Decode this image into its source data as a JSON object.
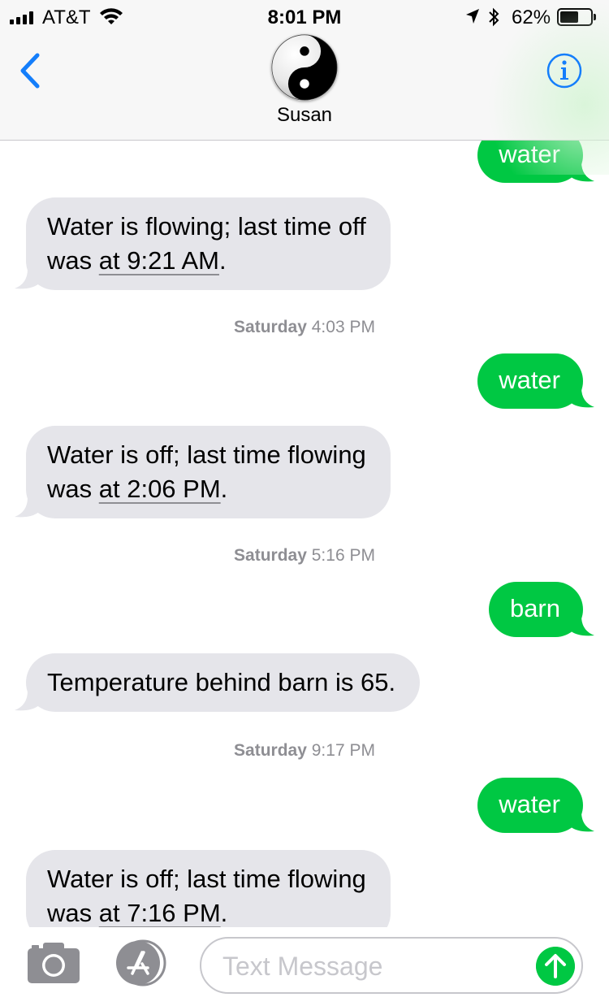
{
  "status_bar": {
    "carrier": "AT&T",
    "time": "8:01 PM",
    "battery_percent": "62%",
    "battery_level": 0.62,
    "icons": [
      "signal-icon",
      "wifi-icon",
      "location-arrow-icon",
      "bluetooth-icon",
      "battery-icon"
    ]
  },
  "header": {
    "contact_name": "Susan",
    "avatar_icon": "yin-yang-icon",
    "back_icon": "chevron-left-icon",
    "info_icon": "info-icon"
  },
  "messages": [
    {
      "kind": "outgoing",
      "text": "water"
    },
    {
      "kind": "incoming",
      "line1": "Water is flowing; last time off",
      "line2_pre": "was ",
      "line2_link": "at 9:21 AM",
      "line2_post": "."
    },
    {
      "kind": "timestamp",
      "day": "Saturday",
      "time": "4:03 PM"
    },
    {
      "kind": "outgoing",
      "text": "water"
    },
    {
      "kind": "incoming",
      "line1": "Water is off; last time flowing",
      "line2_pre": "was ",
      "line2_link": "at 2:06 PM",
      "line2_post": "."
    },
    {
      "kind": "timestamp",
      "day": "Saturday",
      "time": "5:16 PM"
    },
    {
      "kind": "outgoing",
      "text": "barn"
    },
    {
      "kind": "incoming",
      "line1": "Temperature behind barn is 65."
    },
    {
      "kind": "timestamp",
      "day": "Saturday",
      "time": "9:17 PM"
    },
    {
      "kind": "outgoing",
      "text": "water"
    },
    {
      "kind": "incoming",
      "line1": "Water is off; last time flowing",
      "line2_pre": "was ",
      "line2_link": "at 7:16 PM",
      "line2_post": "."
    }
  ],
  "input_bar": {
    "placeholder": "Text Message",
    "camera_icon": "camera-icon",
    "apps_icon": "app-store-icon",
    "send_icon": "send-arrow-icon"
  },
  "colors": {
    "outgoing_bubble": "#00c843",
    "incoming_bubble": "#e5e5ea",
    "accent": "#147efb",
    "muted_text": "#8e8e93"
  }
}
